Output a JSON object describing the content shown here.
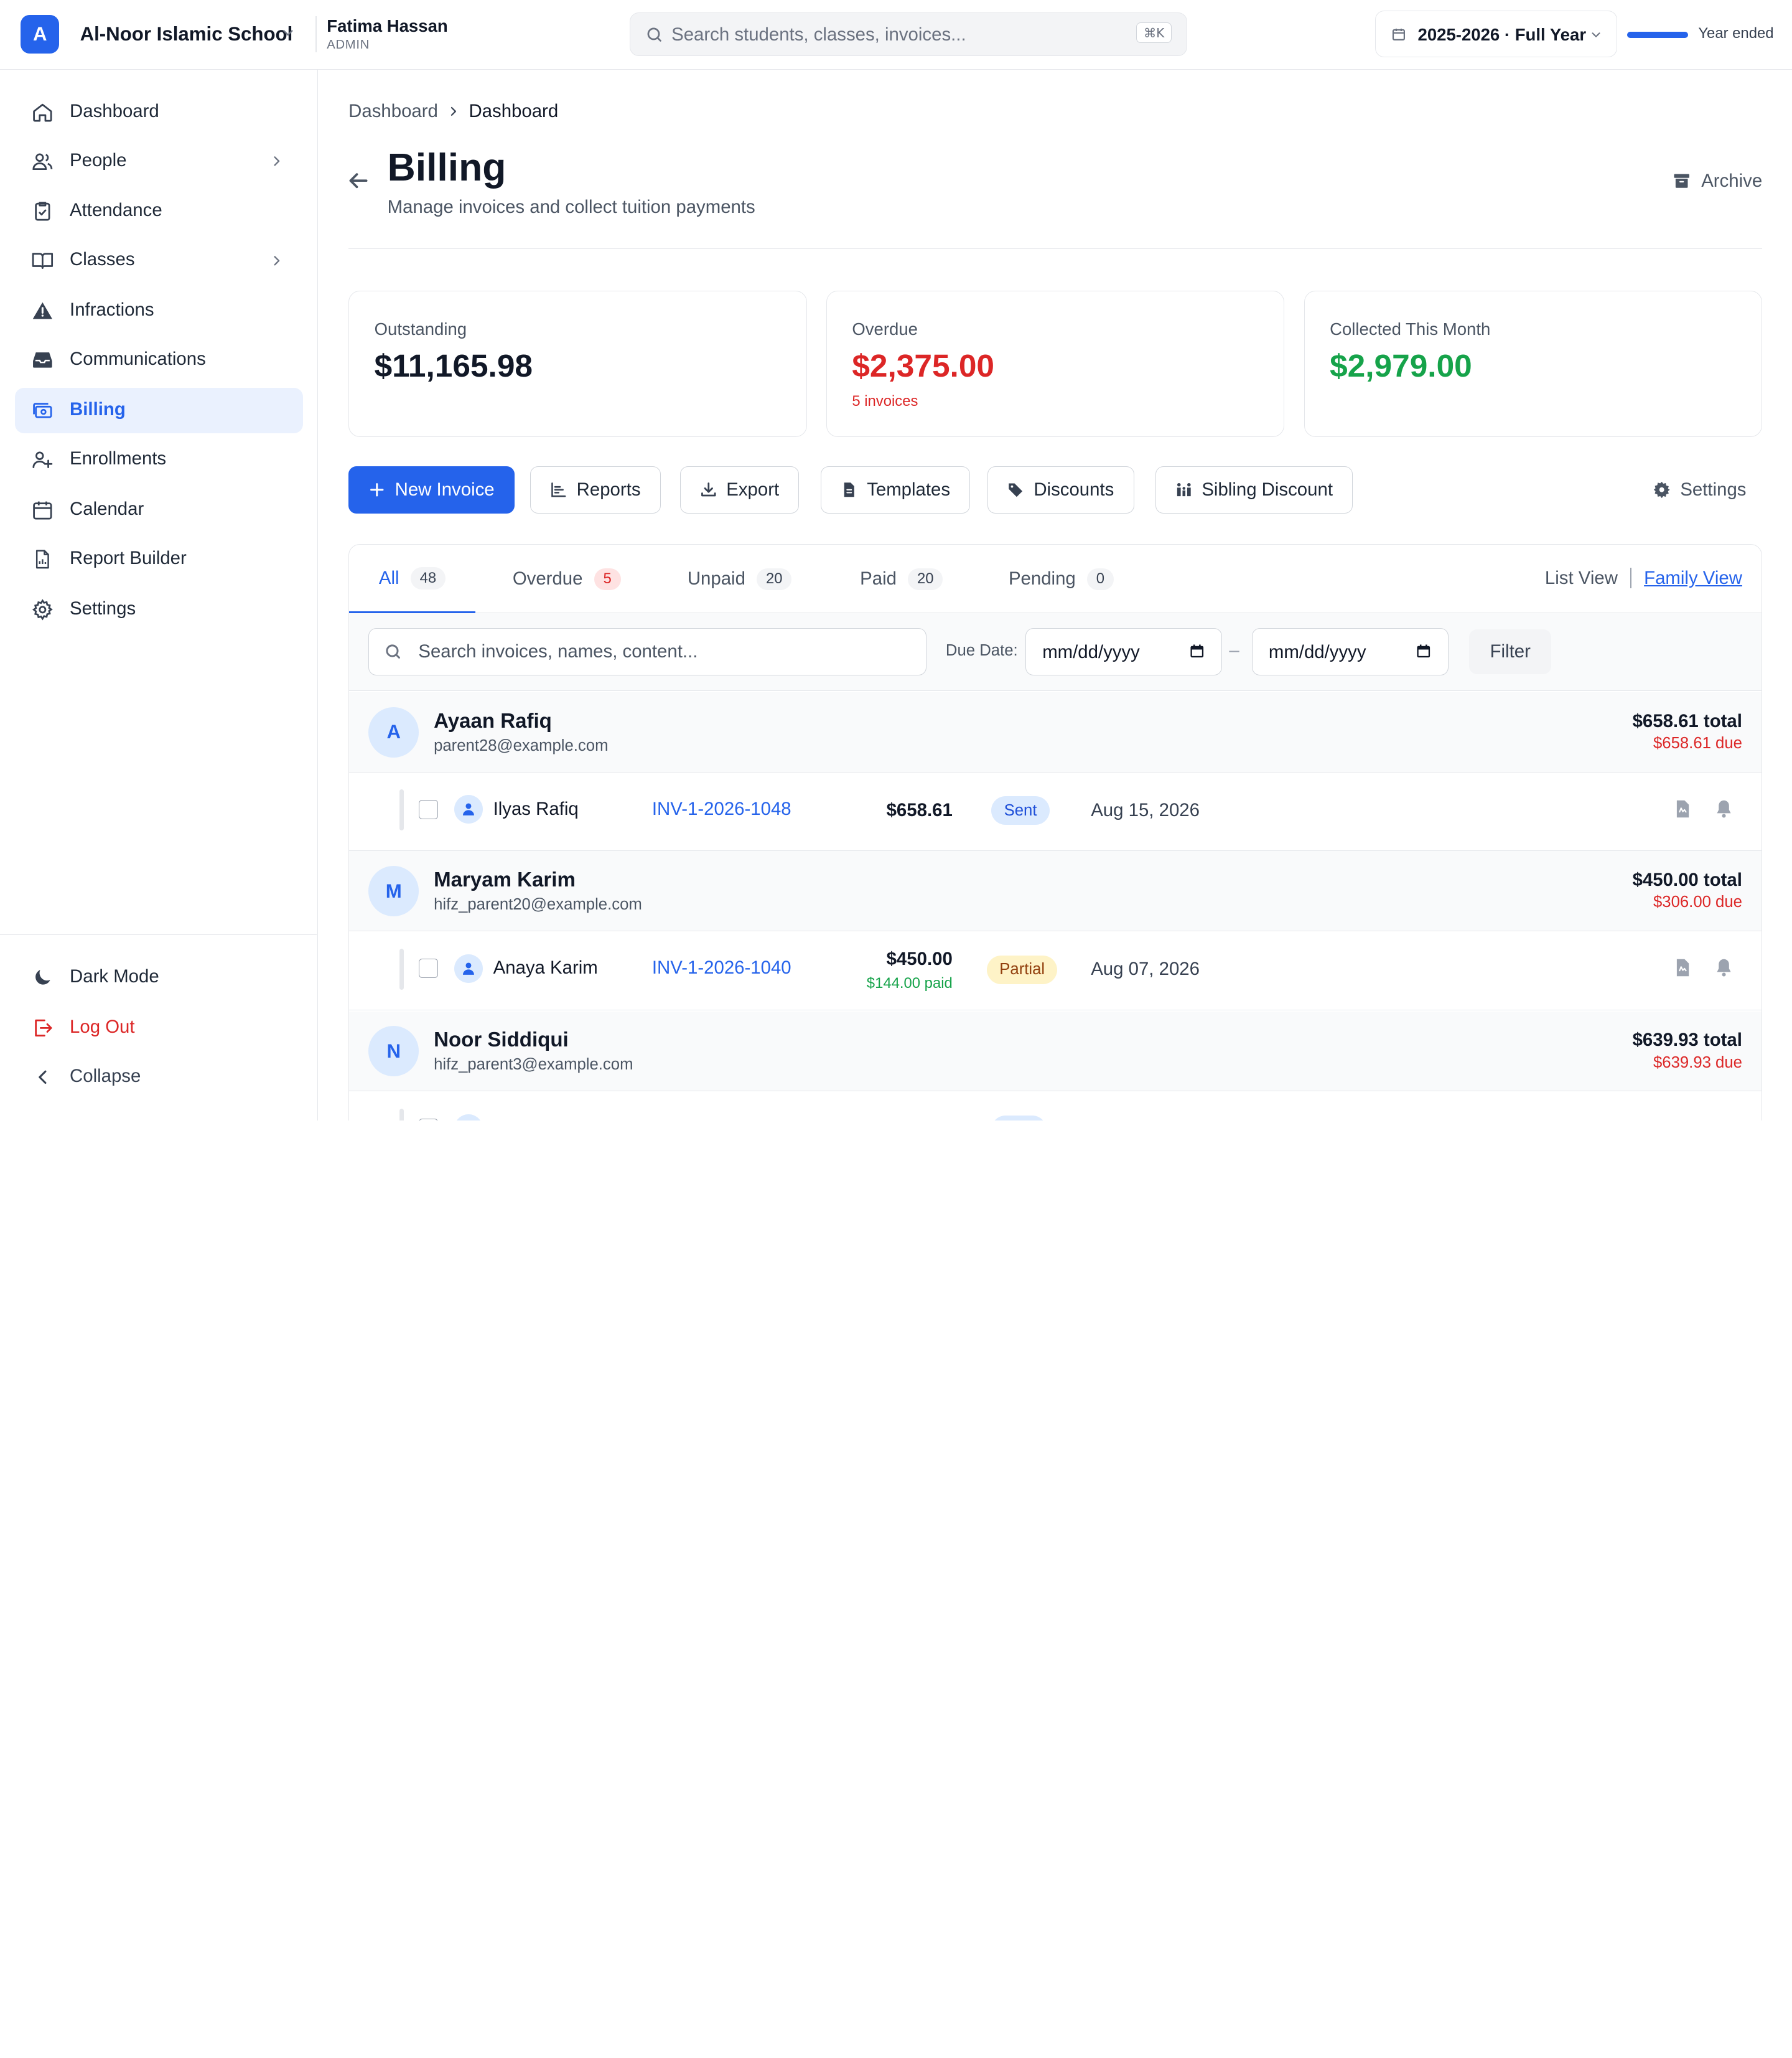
{
  "app": {
    "org_initial": "A",
    "org_name": "Al-Noor Islamic School",
    "user_name": "Fatima Hassan",
    "user_role": "ADMIN",
    "search_placeholder": "Search students, classes, invoices...",
    "search_shortcut": "⌘K",
    "year_label": "2025-2026 · Full Year",
    "year_progress": 1.0,
    "year_status": "Year ended",
    "accent": "#2563eb"
  },
  "sidebar": {
    "items": [
      {
        "label": "Dashboard",
        "icon": "home-icon"
      },
      {
        "label": "People",
        "icon": "users-icon",
        "has_children": true
      },
      {
        "label": "Attendance",
        "icon": "clipboard-check-icon"
      },
      {
        "label": "Classes",
        "icon": "book-icon",
        "has_children": true
      },
      {
        "label": "Infractions",
        "icon": "warning-icon"
      },
      {
        "label": "Communications",
        "icon": "inbox-icon"
      },
      {
        "label": "Billing",
        "icon": "billing-icon",
        "active": true
      },
      {
        "label": "Enrollments",
        "icon": "user-plus-icon"
      },
      {
        "label": "Calendar",
        "icon": "calendar-icon"
      },
      {
        "label": "Report Builder",
        "icon": "report-icon"
      },
      {
        "label": "Settings",
        "icon": "gear-icon"
      }
    ],
    "footer": {
      "dark_mode": "Dark Mode",
      "logout": "Log Out",
      "collapse": "Collapse"
    }
  },
  "page": {
    "breadcrumb": [
      "Dashboard",
      "Dashboard"
    ],
    "title": "Billing",
    "subtitle": "Manage invoices and collect tuition payments",
    "archive": "Archive"
  },
  "stats": [
    {
      "label": "Outstanding",
      "value": "$11,165.98",
      "color": "#111827"
    },
    {
      "label": "Overdue",
      "value": "$2,375.00",
      "note": "5 invoices",
      "color": "#dc2626"
    },
    {
      "label": "Collected This Month",
      "value": "$2,979.00",
      "color": "#16a34a"
    }
  ],
  "actions": {
    "new_invoice": "New Invoice",
    "reports": "Reports",
    "export": "Export",
    "templates": "Templates",
    "discounts": "Discounts",
    "sibling_discount": "Sibling Discount",
    "settings": "Settings"
  },
  "tabs": [
    {
      "label": "All",
      "count": "48",
      "active": true
    },
    {
      "label": "Overdue",
      "count": "5"
    },
    {
      "label": "Unpaid",
      "count": "20"
    },
    {
      "label": "Paid",
      "count": "20"
    },
    {
      "label": "Pending",
      "count": "0"
    }
  ],
  "views": {
    "list": "List View",
    "family": "Family View"
  },
  "filters": {
    "search_placeholder": "Search invoices, names, content...",
    "due_date_label": "Due Date:",
    "date_from": "mm/dd/yyyy",
    "date_to": "mm/dd/yyyy",
    "separator": "–",
    "filter_button": "Filter"
  },
  "families": [
    {
      "initial": "A",
      "name": "Ayaan Rafiq",
      "email": "parent28@example.com",
      "total": "$658.61 total",
      "due": "$658.61 due",
      "invoices": [
        {
          "student": "Ilyas Rafiq",
          "number": "INV-1-2026-1048",
          "amount": "$658.61",
          "paid": "",
          "status": "Sent",
          "date": "Aug 15, 2026"
        }
      ]
    },
    {
      "initial": "M",
      "name": "Maryam Karim",
      "email": "hifz_parent20@example.com",
      "total": "$450.00 total",
      "due": "$306.00 due",
      "invoices": [
        {
          "student": "Anaya Karim",
          "number": "INV-1-2026-1040",
          "amount": "$450.00",
          "paid": "$144.00 paid",
          "status": "Partial",
          "date": "Aug 07, 2026"
        }
      ]
    },
    {
      "initial": "N",
      "name": "Noor Siddiqui",
      "email": "hifz_parent3@example.com",
      "total": "$639.93 total",
      "due": "$639.93 due",
      "invoices": []
    }
  ]
}
